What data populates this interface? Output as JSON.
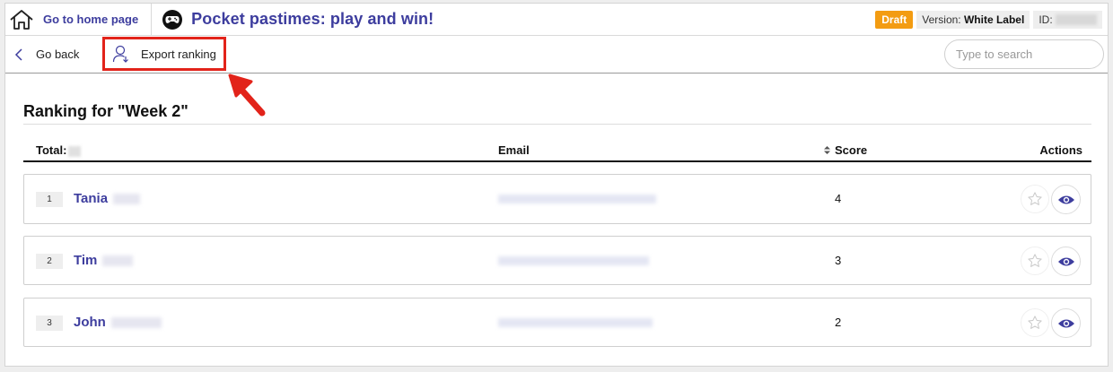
{
  "header": {
    "home_label": "Go to home page",
    "game_title": "Pocket pastimes: play and win!",
    "status_badge": "Draft",
    "version_prefix": "Version: ",
    "version_value": "White Label",
    "id_label": "ID:",
    "accent_color": "#3d3d9e",
    "draft_color": "#f39c12"
  },
  "toolbar": {
    "go_back_label": "Go back",
    "export_label": "Export ranking",
    "search_placeholder": "Type to search",
    "highlight_color": "#e2231a"
  },
  "ranking": {
    "title": "Ranking for \"Week 2\"",
    "columns": {
      "total": "Total:",
      "email": "Email",
      "score": "Score",
      "actions": "Actions"
    },
    "rows": [
      {
        "rank": "1",
        "first_name": "Tania",
        "score": "4"
      },
      {
        "rank": "2",
        "first_name": "Tim",
        "score": "3"
      },
      {
        "rank": "3",
        "first_name": "John",
        "score": "2"
      }
    ]
  },
  "icons": {
    "home": "home-icon",
    "gamepad": "gamepad-icon",
    "back": "chevron-left-icon",
    "export": "user-export-icon",
    "search": "search-icon",
    "sort": "sort-icon",
    "star": "star-icon",
    "view": "eye-icon"
  }
}
